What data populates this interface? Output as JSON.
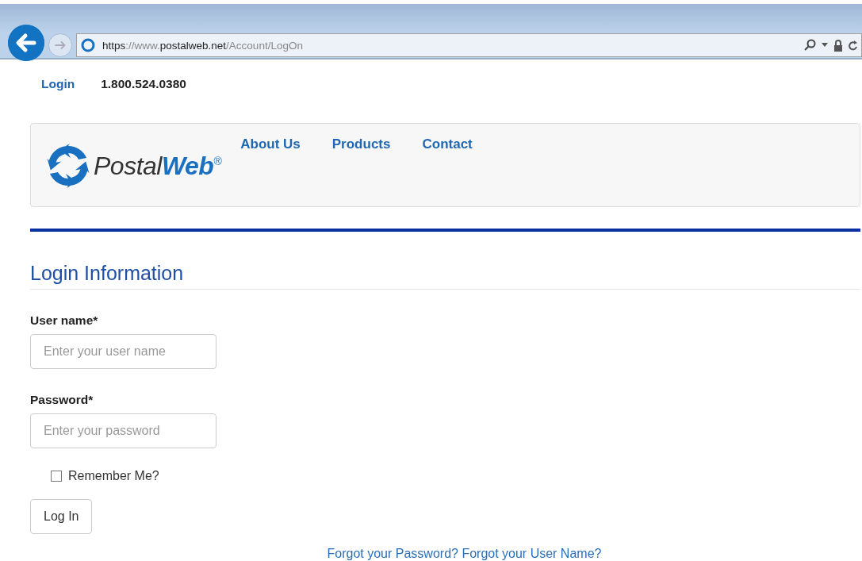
{
  "browser": {
    "url": "**https**://www.**postalweb.net**/Account/LogOn"
  },
  "top_links": [
    {
      "kind": "link",
      "text": "Login"
    },
    {
      "kind": "phone",
      "text": "1.800.524.0380"
    }
  ],
  "header": {
    "logo": "Postal**Web**$^{®}$",
    "nav": [
      "About Us",
      "Products",
      "Contact"
    ]
  },
  "form": {
    "title": "Login Information",
    "fields": [
      {
        "label": "User name*",
        "placeholder": "Enter your user name"
      },
      {
        "label": "Password*",
        "placeholder": "Enter your password"
      }
    ],
    "remember": {
      "label": "Remember Me?",
      "checked": false
    },
    "submit": "Log In",
    "links": "Forgot your Password? Forgot your User Name?"
  }
}
